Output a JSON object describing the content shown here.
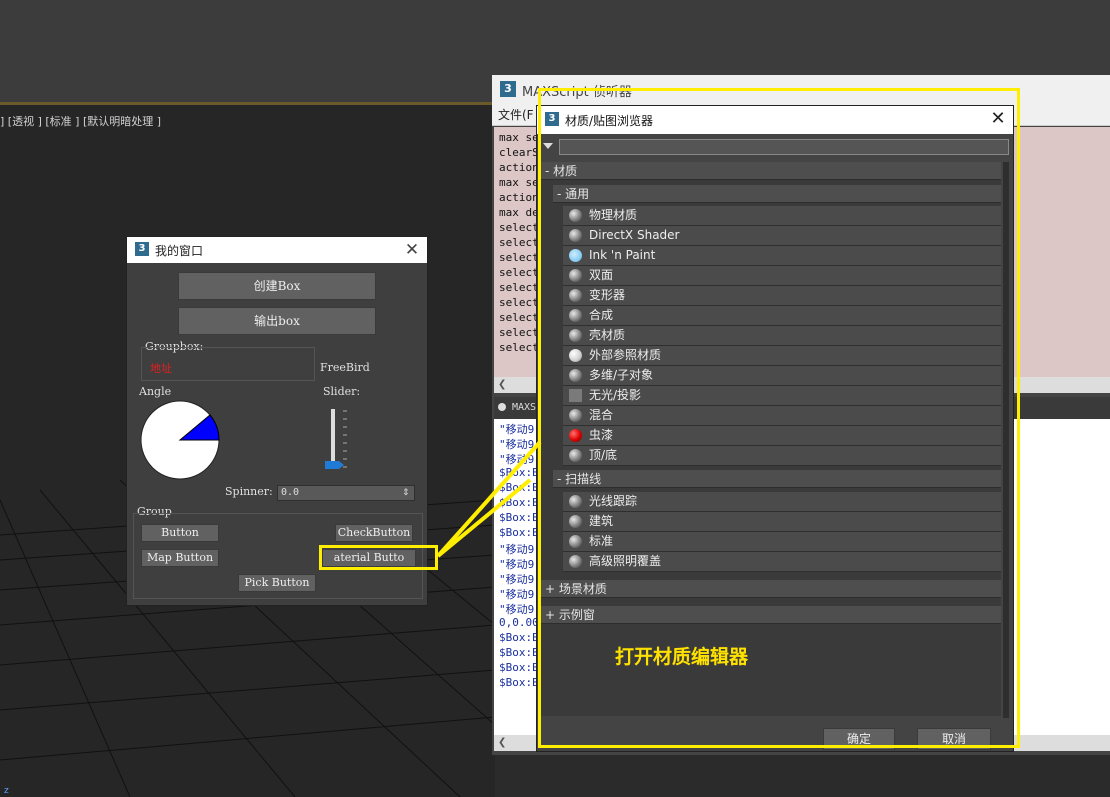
{
  "viewport": {
    "label": "] [透视 ] [标准 ] [默认明暗处理 ]",
    "axis_label": "z"
  },
  "listener": {
    "title": "MAXScript 侦听器",
    "menu_file": "文件(F",
    "top_lines": [
      "max se",
      "clearS",
      "action",
      "max se",
      "action",
      "max de",
      "select",
      "select",
      "select",
      "select",
      "select",
      "select",
      "select",
      "select",
      "select"
    ],
    "split_label": "MAXS",
    "bottom_lines": [
      {
        "text": "\"移动9",
        "color": "#1a2fa0"
      },
      {
        "text": "\"移动9",
        "color": "#1a2fa0"
      },
      {
        "text": "\"移动9",
        "color": "#1a2fa0"
      },
      {
        "text": "$Box:B",
        "color": "#1a2fa0"
      },
      {
        "text": "$Box:B",
        "color": "#1a2fa0"
      },
      {
        "text": "$Box:B",
        "color": "#1a2fa0"
      },
      {
        "text": "$Box:B",
        "color": "#1a2fa0"
      },
      {
        "text": "$Box:B",
        "color": "#1a2fa0"
      },
      {
        "text": "\"移动9",
        "color": "#1a2fa0"
      },
      {
        "text": "\"移动9",
        "color": "#1a2fa0"
      },
      {
        "text": "\"移动9",
        "color": "#1a2fa0"
      },
      {
        "text": "\"移动9",
        "color": "#1a2fa0"
      },
      {
        "text": "\"移动9",
        "color": "#1a2fa0"
      },
      {
        "text": "0,0.00",
        "color": "#1a2fa0"
      },
      {
        "text": "$Box:B",
        "color": "#1a2fa0"
      },
      {
        "text": "$Box:B",
        "color": "#1a2fa0"
      },
      {
        "text": "$Box:B",
        "color": "#1a2fa0"
      },
      {
        "text": "$Box:B",
        "color": "#1a2fa0"
      }
    ]
  },
  "material_browser": {
    "title": "材质/贴图浏览器",
    "close": "✕",
    "sections": {
      "materials": "- 材质",
      "general": "- 通用",
      "scanline": "- 扫描线",
      "scene_materials": "+ 场景材质",
      "sample_slots": "+ 示例窗"
    },
    "general_items": [
      {
        "label": "物理材质",
        "swatch": "sphere"
      },
      {
        "label": "DirectX Shader",
        "swatch": "sphere"
      },
      {
        "label": "Ink 'n Paint",
        "swatch": "light-blue"
      },
      {
        "label": "双面",
        "swatch": "sphere"
      },
      {
        "label": "变形器",
        "swatch": "sphere"
      },
      {
        "label": "合成",
        "swatch": "sphere"
      },
      {
        "label": "壳材质",
        "swatch": "sphere"
      },
      {
        "label": "外部参照材质",
        "swatch": "white-sphere"
      },
      {
        "label": "多维/子对象",
        "swatch": "sphere"
      },
      {
        "label": "无光/投影",
        "swatch": "flat-gray"
      },
      {
        "label": "混合",
        "swatch": "sphere"
      },
      {
        "label": "虫漆",
        "swatch": "red"
      },
      {
        "label": "顶/底",
        "swatch": "sphere"
      }
    ],
    "scanline_items": [
      {
        "label": "光线跟踪",
        "swatch": "sphere"
      },
      {
        "label": "建筑",
        "swatch": "sphere"
      },
      {
        "label": "标准",
        "swatch": "sphere"
      },
      {
        "label": "高级照明覆盖",
        "swatch": "sphere"
      }
    ],
    "ok_label": "确定",
    "cancel_label": "取消"
  },
  "annotation_text": "打开材质编辑器",
  "my_window": {
    "title": "我的窗口",
    "create_box_label": "创建Box",
    "export_box_label": "输出box",
    "groupbox_label": "Groupbox:",
    "groupbox_text": "地址",
    "freebird_label": "FreeBird",
    "angle_label": "Angle",
    "slider_label": "Slider:",
    "spinner_label": "Spinner:",
    "spinner_value": "0.0",
    "group_label": "Group",
    "button_label": "Button",
    "checkbutton_label": "CheckButton",
    "map_button_label": "Map Button",
    "material_button_label": "aterial Butto",
    "pick_button_label": "Pick Button"
  },
  "colors": {
    "highlight": "#ffee00",
    "angle_fill": "#0000ff",
    "slider_thumb": "#1f7bd6",
    "groupbox_text": "#e02020"
  }
}
